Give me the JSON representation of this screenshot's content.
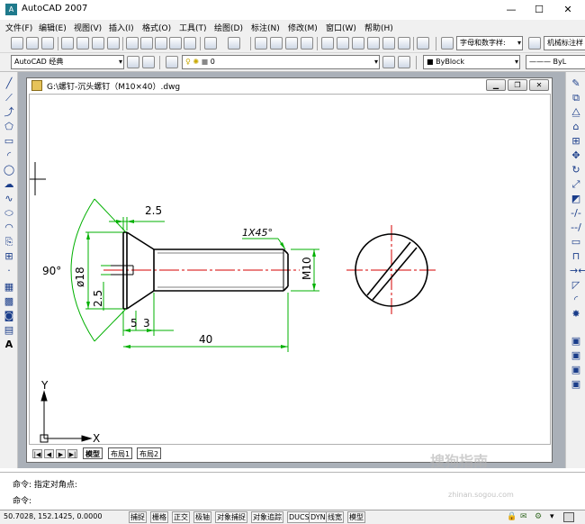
{
  "app": {
    "title": "AutoCAD 2007",
    "icon_glyph": "A",
    "minimize": "—",
    "maximize": "☐",
    "close": "✕"
  },
  "menu": [
    "文件(F)",
    "编辑(E)",
    "视图(V)",
    "插入(I)",
    "格式(O)",
    "工具(T)",
    "绘图(D)",
    "标注(N)",
    "修改(M)",
    "窗口(W)",
    "帮助(H)"
  ],
  "toolbar": {
    "text_style": "字母和数字样:",
    "dim_style": "机械标注样"
  },
  "toolbar2": {
    "workspace": "AutoCAD 经典",
    "layer": "0",
    "color": "ByBlock",
    "linetype": "ByL"
  },
  "document": {
    "title": "G:\\螺钉-沉头螺钉（M10×40）.dwg",
    "tabs": [
      "模型",
      "布局1",
      "布局2"
    ]
  },
  "drawing": {
    "dims": {
      "head_height": "2.5",
      "angle": "90°",
      "diameter": "ø18",
      "slot_depth": "2.5",
      "left_a": "5",
      "left_b": "3",
      "length": "40",
      "chamfer": "1X45°",
      "thread": "M10"
    },
    "ucs": {
      "x": "X",
      "y": "Y"
    },
    "colors": {
      "dim": "#00b000",
      "center": "#d40000",
      "outline": "#000000"
    }
  },
  "command": {
    "line1_prompt": "命令:",
    "line1_text": "指定对角点:",
    "line2_prompt": "命令:"
  },
  "status": {
    "coords": "50.7028,  152.1425, 0.0000",
    "buttons": [
      "捕捉",
      "栅格",
      "正交",
      "极轴",
      "对象捕捉",
      "对象追踪",
      "DUCS",
      "DYN",
      "线宽",
      "模型"
    ]
  },
  "watermark": {
    "text": "搜狗指南",
    "sub": "zhinan.sogou.com"
  }
}
